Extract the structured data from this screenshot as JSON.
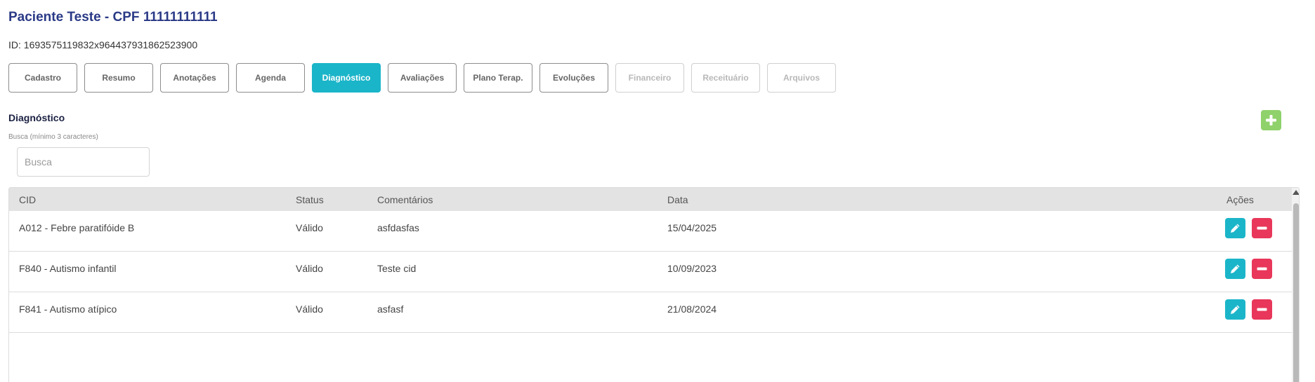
{
  "patient": {
    "title": "Paciente Teste - CPF 11111111111",
    "id_line": "ID: 1693575119832x964437931862523900"
  },
  "tabs": [
    {
      "label": "Cadastro",
      "state": "normal"
    },
    {
      "label": "Resumo",
      "state": "normal"
    },
    {
      "label": "Anotações",
      "state": "normal"
    },
    {
      "label": "Agenda",
      "state": "normal"
    },
    {
      "label": "Diagnóstico",
      "state": "active"
    },
    {
      "label": "Avaliações",
      "state": "normal"
    },
    {
      "label": "Plano Terap.",
      "state": "normal"
    },
    {
      "label": "Evoluções",
      "state": "normal"
    },
    {
      "label": "Financeiro",
      "state": "disabled"
    },
    {
      "label": "Receituário",
      "state": "disabled"
    },
    {
      "label": "Arquivos",
      "state": "disabled"
    }
  ],
  "section": {
    "title": "Diagnóstico",
    "search_label": "Busca (mínimo 3 caracteres)",
    "search_placeholder": "Busca",
    "search_value": "",
    "add_icon": "plus-icon"
  },
  "table": {
    "headers": {
      "cid": "CID",
      "status": "Status",
      "comentarios": "Comentários",
      "data": "Data",
      "acoes": "Ações"
    },
    "rows": [
      {
        "cid": "A012 - Febre paratifóide B",
        "status": "Válido",
        "comentarios": "asfdasfas",
        "data": "15/04/2025"
      },
      {
        "cid": "F840 - Autismo infantil",
        "status": "Válido",
        "comentarios": "Teste cid",
        "data": "10/09/2023"
      },
      {
        "cid": "F841 - Autismo atípico",
        "status": "Válido",
        "comentarios": "asfasf",
        "data": "21/08/2024"
      }
    ],
    "edit_icon": "pencil-icon",
    "remove_icon": "minus-icon"
  },
  "colors": {
    "title": "#2a3a86",
    "active_tab": "#1bb5c9",
    "add_button": "#8fd16b",
    "edit_button": "#1bb5c9",
    "remove_button": "#e8375a",
    "header_bg": "#e3e3e3"
  }
}
